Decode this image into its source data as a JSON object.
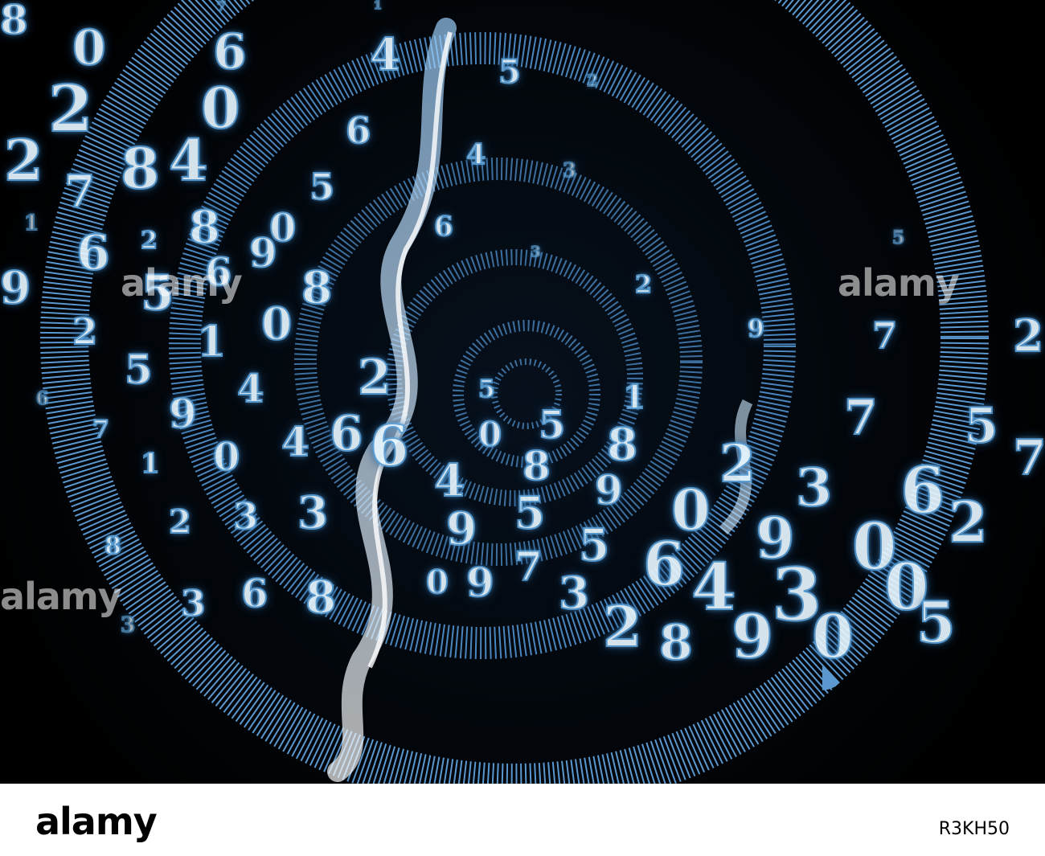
{
  "image": {
    "subject": "abstract-digital-tunnel",
    "colors": {
      "background": "#000000",
      "glow": "#4a90c8",
      "digit_fill": "#e6f6ff"
    }
  },
  "digits": [
    "8",
    "7",
    "1",
    "0",
    "4",
    "6",
    "5",
    "2",
    "2",
    "0",
    "6",
    "4",
    "2",
    "8",
    "4",
    "3",
    "5",
    "7",
    "1",
    "0",
    "6",
    "8",
    "2",
    "5",
    "3",
    "6",
    "9",
    "6",
    "9",
    "5",
    "8",
    "2",
    "0",
    "2",
    "7",
    "1",
    "5",
    "2",
    "9",
    "4",
    "5",
    "1",
    "2",
    "6",
    "9",
    "6",
    "4",
    "0",
    "5",
    "6",
    "7",
    "5",
    "8",
    "8",
    "0",
    "4",
    "7",
    "1",
    "2",
    "3",
    "6",
    "0",
    "9",
    "7",
    "5",
    "9",
    "3",
    "3",
    "2",
    "9",
    "0",
    "2",
    "5",
    "8",
    "7",
    "9",
    "0",
    "6",
    "4",
    "3",
    "0",
    "3",
    "6",
    "8",
    "3",
    "5",
    "0",
    "9",
    "8",
    "2",
    "3"
  ],
  "watermarks": {
    "top_left": "alamy",
    "top_right": "alamy",
    "bottom_left": "alamy"
  },
  "footer": {
    "logo": "alamy",
    "image_id": "R3KH50"
  }
}
